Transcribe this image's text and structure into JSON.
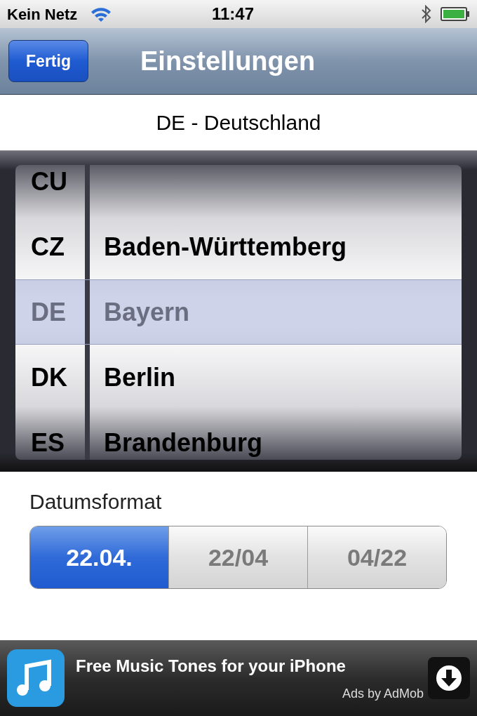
{
  "status_bar": {
    "carrier": "Kein Netz",
    "time": "11:47"
  },
  "nav_bar": {
    "button": "Fertig",
    "title": "Einstellungen"
  },
  "current_selection": "DE - Deutschland",
  "picker": {
    "rows": [
      {
        "code": "CU",
        "region": "",
        "selected": false
      },
      {
        "code": "CZ",
        "region": "Baden-Württemberg",
        "selected": false
      },
      {
        "code": "DE",
        "region": "Bayern",
        "selected": true
      },
      {
        "code": "DK",
        "region": "Berlin",
        "selected": false
      },
      {
        "code": "ES",
        "region": "Brandenburg",
        "selected": false
      }
    ]
  },
  "date_format": {
    "label": "Datumsformat",
    "segments": [
      {
        "label": "22.04.",
        "selected": true
      },
      {
        "label": "22/04",
        "selected": false
      },
      {
        "label": "04/22",
        "selected": false
      }
    ]
  },
  "ad": {
    "title": "Free Music Tones for your iPhone",
    "byline": "Ads by AdMob"
  }
}
